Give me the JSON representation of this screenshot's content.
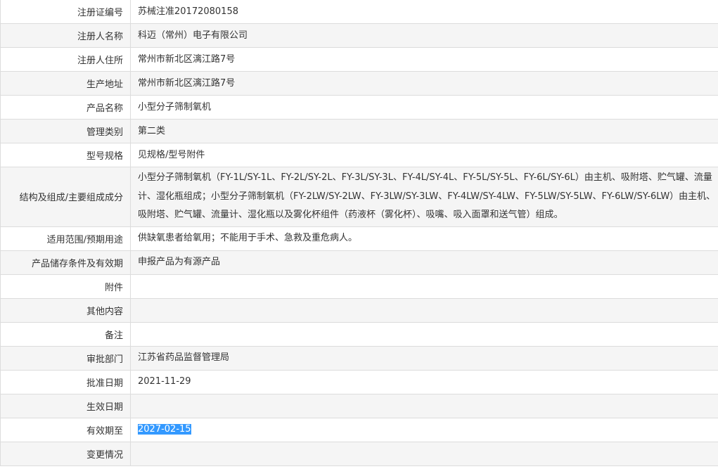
{
  "rows": [
    {
      "label": "注册证编号",
      "value": "苏械注准20172080158"
    },
    {
      "label": "注册人名称",
      "value": "科迈（常州）电子有限公司"
    },
    {
      "label": "注册人住所",
      "value": "常州市新北区漓江路7号"
    },
    {
      "label": "生产地址",
      "value": "常州市新北区漓江路7号"
    },
    {
      "label": "产品名称",
      "value": "小型分子筛制氧机"
    },
    {
      "label": "管理类别",
      "value": "第二类"
    },
    {
      "label": "型号规格",
      "value": "见规格/型号附件"
    },
    {
      "label": "结构及组成/主要组成成分",
      "value": "小型分子筛制氧机（FY-1L/SY-1L、FY-2L/SY-2L、FY-3L/SY-3L、FY-4L/SY-4L、FY-5L/SY-5L、FY-6L/SY-6L）由主机、吸附塔、贮气罐、流量计、湿化瓶组成；小型分子筛制氧机（FY-2LW/SY-2LW、FY-3LW/SY-3LW、FY-4LW/SY-4LW、FY-5LW/SY-5LW、FY-6LW/SY-6LW）由主机、吸附塔、贮气罐、流量计、湿化瓶以及雾化杯组件（药液杯（雾化杯）、吸嘴、吸入面罩和送气管）组成。"
    },
    {
      "label": "适用范围/预期用途",
      "value": "供缺氧患者给氧用；不能用于手术、急救及重危病人。"
    },
    {
      "label": "产品储存条件及有效期",
      "value": "申报产品为有源产品"
    },
    {
      "label": "附件",
      "value": ""
    },
    {
      "label": "其他内容",
      "value": ""
    },
    {
      "label": "备注",
      "value": ""
    },
    {
      "label": "审批部门",
      "value": "江苏省药品监督管理局"
    },
    {
      "label": "批准日期",
      "value": "2021-11-29"
    },
    {
      "label": "生效日期",
      "value": ""
    },
    {
      "label": "有效期至",
      "value": "2027-02-15"
    },
    {
      "label": "变更情况",
      "value": ""
    }
  ]
}
